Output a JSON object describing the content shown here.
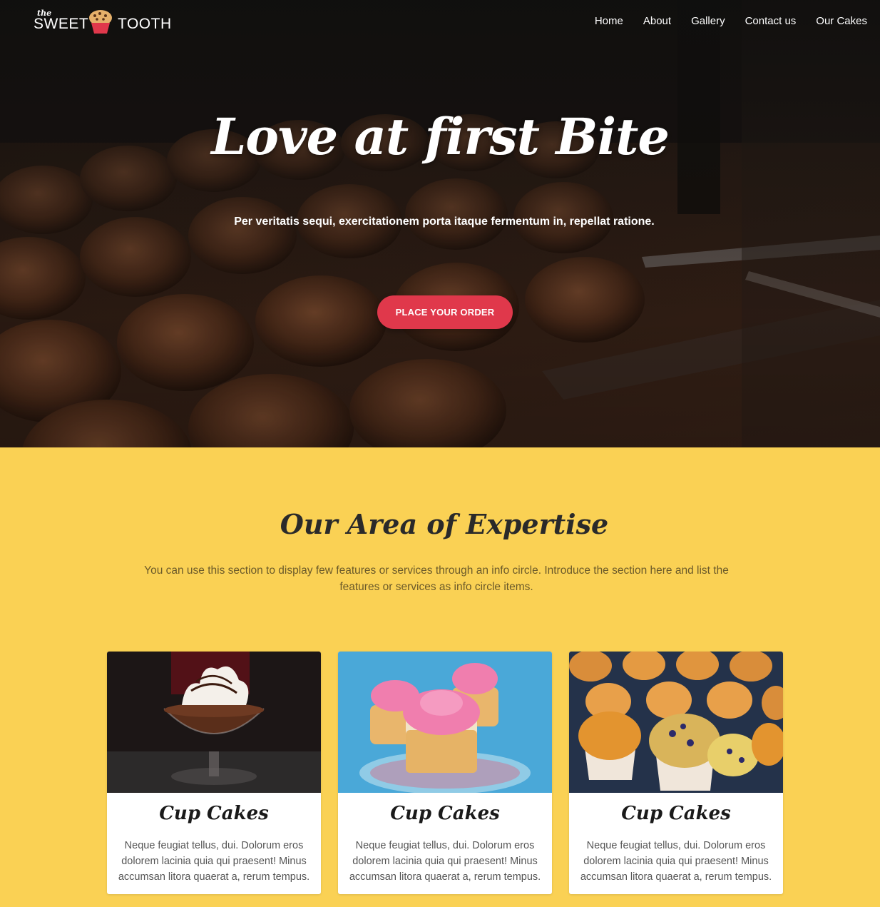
{
  "brand": {
    "small": "the",
    "left": "SWEET",
    "right": "TOOTH"
  },
  "nav": {
    "items": [
      "Home",
      "About",
      "Gallery",
      "Contact us",
      "Our Cakes"
    ]
  },
  "hero": {
    "title": "Love at first Bite",
    "subtitle": "Per veritatis sequi, exercitationem porta itaque fermentum in, repellat ratione.",
    "cta": "PLACE YOUR ORDER"
  },
  "expertise": {
    "title": "Our Area of Expertise",
    "description": "You can use this section to display few features or services through an info circle. Introduce the section here and list the features or services as info circle items."
  },
  "cards": [
    {
      "title": "Cup Cakes",
      "text": "Neque feugiat tellus, dui. Dolorum eros dolorem lacinia quia qui praesent! Minus accumsan litora quaerat a, rerum tempus."
    },
    {
      "title": "Cup Cakes",
      "text": "Neque feugiat tellus, dui. Dolorum eros dolorem lacinia quia qui praesent! Minus accumsan litora quaerat a, rerum tempus."
    },
    {
      "title": "Cup Cakes",
      "text": "Neque feugiat tellus, dui. Dolorum eros dolorem lacinia quia qui praesent! Minus accumsan litora quaerat a, rerum tempus."
    }
  ],
  "colors": {
    "accent": "#e0384b",
    "section_bg": "#fad154",
    "hero_dark": "#1a1210"
  }
}
